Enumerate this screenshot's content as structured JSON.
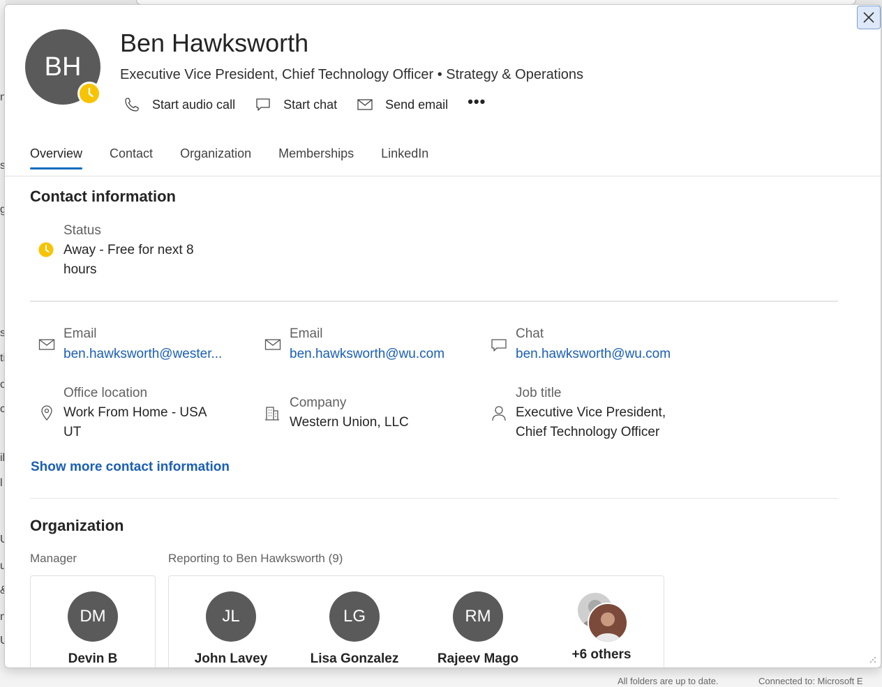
{
  "background": {
    "fragments": [
      "n",
      "s",
      "g",
      "s",
      "ti",
      "o",
      "ce",
      "ili",
      "l",
      "U",
      "u",
      "&",
      "n",
      "U"
    ],
    "status_left": "All folders are up to date.",
    "status_right": "Connected to: Microsoft E"
  },
  "card": {
    "close_label": "Close",
    "avatar_initials": "BH",
    "presence": "away",
    "name": "Ben Hawksworth",
    "subtitle": "Executive Vice President, Chief Technology Officer • Strategy & Operations",
    "actions": [
      {
        "label": "Start audio call",
        "icon": "phone-icon"
      },
      {
        "label": "Start chat",
        "icon": "chat-icon"
      },
      {
        "label": "Send email",
        "icon": "mail-icon"
      }
    ],
    "more_label": "•••"
  },
  "tabs": [
    {
      "label": "Overview",
      "active": true
    },
    {
      "label": "Contact",
      "active": false
    },
    {
      "label": "Organization",
      "active": false
    },
    {
      "label": "Memberships",
      "active": false
    },
    {
      "label": "LinkedIn",
      "active": false
    }
  ],
  "contact": {
    "title": "Contact information",
    "status_label": "Status",
    "status_line1": "Away - Free for next 8",
    "status_line2": "hours",
    "email1_label": "Email",
    "email1_value": "ben.hawksworth@wester...",
    "email2_label": "Email",
    "email2_value": "ben.hawksworth@wu.com",
    "chat_label": "Chat",
    "chat_value": "ben.hawksworth@wu.com",
    "office_label": "Office location",
    "office_line1": "Work From Home - USA",
    "office_line2": "UT",
    "company_label": "Company",
    "company_value": "Western Union, LLC",
    "job_label": "Job title",
    "job_line1": "Executive Vice President,",
    "job_line2": "Chief Technology Officer",
    "show_more": "Show more contact information"
  },
  "organization": {
    "title": "Organization",
    "manager_label": "Manager",
    "reports_label": "Reporting to Ben Hawksworth (9)",
    "manager": {
      "initials": "DM",
      "name": "Devin B"
    },
    "reports": [
      {
        "initials": "JL",
        "name": "John Lavey"
      },
      {
        "initials": "LG",
        "name": "Lisa Gonzalez"
      },
      {
        "initials": "RM",
        "name": "Rajeev Mago"
      }
    ],
    "others_label": "+6 others"
  },
  "colors": {
    "accent": "#0f6cbd",
    "link": "#1a5fb4",
    "away": "#f8c301",
    "avatar": "#5a5a5a"
  }
}
